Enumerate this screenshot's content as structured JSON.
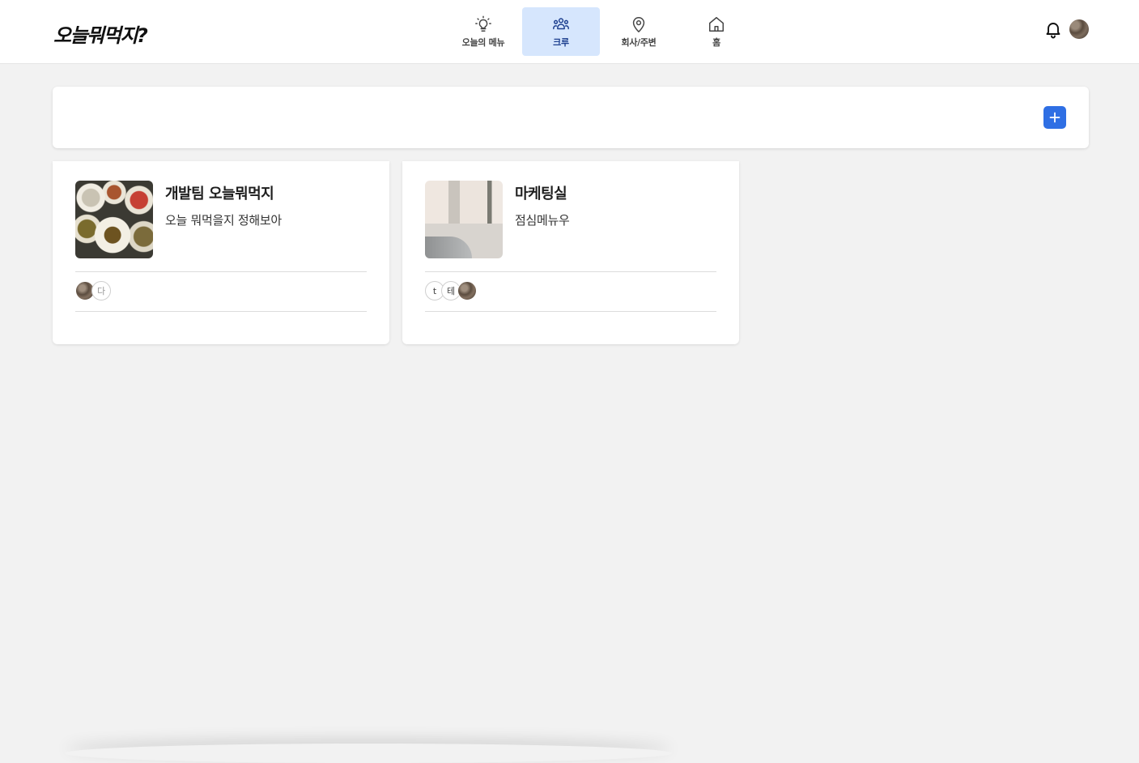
{
  "header": {
    "logo": "오늘뭐먹지?",
    "nav": [
      {
        "label": "오늘의 메뉴",
        "icon": "lightbulb-icon",
        "active": false
      },
      {
        "label": "크루",
        "icon": "users-icon",
        "active": true
      },
      {
        "label": "회사/주변",
        "icon": "map-pin-icon",
        "active": false
      },
      {
        "label": "홈",
        "icon": "home-icon",
        "active": false
      }
    ]
  },
  "toolbar": {
    "add_icon": "plus-icon",
    "accent": "#2f6fe4"
  },
  "crews": [
    {
      "name": "개발팀 오늘뭐먹지",
      "description": "오늘 뭐먹을지 정해보아",
      "thumbnail": "food-photo",
      "members": [
        {
          "type": "photo",
          "text": ""
        },
        {
          "type": "initial",
          "text": "다"
        }
      ]
    },
    {
      "name": "마케팅실",
      "description": "점심메뉴우",
      "thumbnail": "room-photo",
      "members": [
        {
          "type": "initial",
          "text": "t"
        },
        {
          "type": "initial",
          "text": "테"
        },
        {
          "type": "photo",
          "text": ""
        }
      ]
    }
  ],
  "colors": {
    "background": "#f2f2f2",
    "nav_active_bg": "#d6e6fd",
    "nav_active_text": "#1d3f8f"
  }
}
